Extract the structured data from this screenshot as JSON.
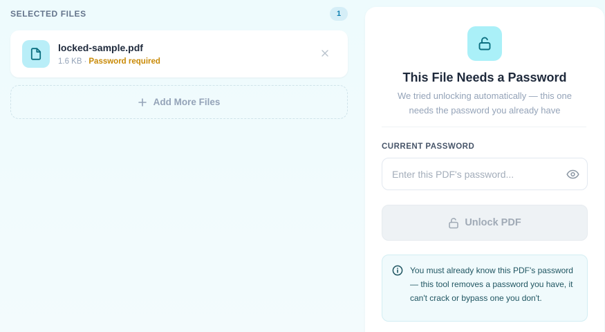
{
  "files_panel": {
    "title": "SELECTED FILES",
    "count": "1",
    "files": [
      {
        "name": "locked-sample.pdf",
        "size": "1.6 KB",
        "separator": "·",
        "status": "Password required",
        "icon": "file-icon",
        "remove_icon": "close-icon"
      }
    ],
    "add_more_label": "Add More Files"
  },
  "password_panel": {
    "icon": "unlock-icon",
    "title": "This File Needs a Password",
    "subtitle": "We tried unlocking automatically — this one needs the password you already have",
    "field_label": "CURRENT PASSWORD",
    "input_value": "",
    "input_placeholder": "Enter this PDF's password...",
    "toggle_icon": "eye-icon",
    "unlock_label": "Unlock PDF",
    "info_text": "You must already know this PDF's password — this tool removes a password you have, it can't crack or bypass one you don't."
  },
  "colors": {
    "accent": "#0e7fb0",
    "icon_bg": "#aaf0f8",
    "warning": "#c98a06",
    "disabled_button": "#eef2f5"
  }
}
